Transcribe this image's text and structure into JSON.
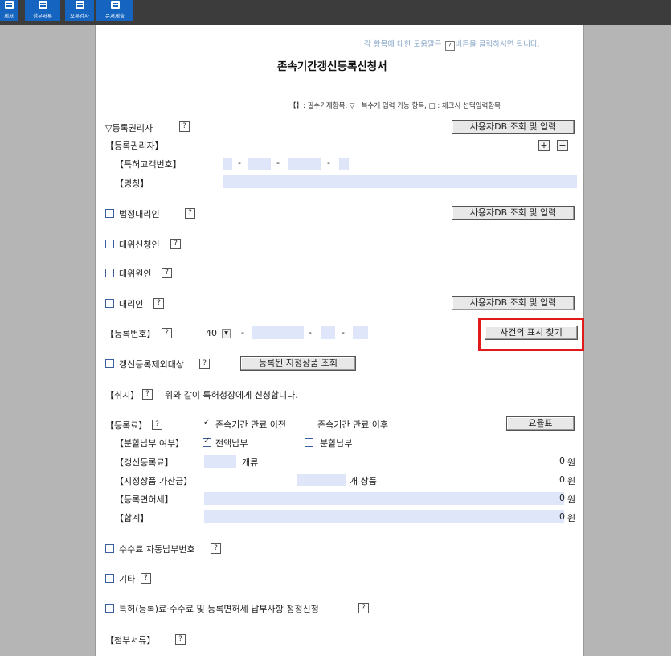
{
  "toolbar": {
    "buttons": [
      {
        "label": "세서"
      },
      {
        "label": "첨부서류"
      },
      {
        "label": "오류검사"
      },
      {
        "label": "문서제출"
      }
    ]
  },
  "doc": {
    "help_text_pre": "각 항목에 대한 도움말은",
    "help_text_post": "버튼을 클릭하시면 됩니다.",
    "qmark": "?",
    "title": "존속기간갱신등록신청서",
    "legend": "【】: 필수기재항목,  ▽ : 복수개 입력 가능 항목,  □ : 체크시 선택입력항목",
    "registrant_section": "▽등록권리자",
    "registrant_header": "【등록권리자】",
    "customer_no_label": "【특허고객번호】",
    "name_label": "【명칭】",
    "legal_rep_label": "법정대리인",
    "proxy_applicant_label": "대위신청인",
    "proxy_origin_label": "대위원인",
    "agent_label": "대리인",
    "reg_no_label": "【등록번호】",
    "reg_no_prefix": "40",
    "renewal_exclusion_label": "갱신등록제외대상",
    "purpose_label": "【취지】",
    "purpose_text": "위와 같이 특허청장에게 신청합니다.",
    "fee_label": "【등록료】",
    "before_expiry": "존속기간 만료 이전",
    "after_expiry": "존속기간 만료 이후",
    "installment_label": "【분할납부 여부】",
    "full_payment": "전액납부",
    "installment": "분할납부",
    "renewal_fee_label": "【갱신등록료】",
    "class_suffix": "개류",
    "designated_goods_label": "【지정상품 가산금】",
    "goods_suffix": "개 상품",
    "license_tax_label": "【등록면허세】",
    "total_label": "【합계】",
    "amount_zero": "0",
    "won": "원",
    "auto_pay_label": "수수료 자동납부번호",
    "other_label": "기타",
    "correction_label": "특허(등록)료·수수료 및 등록면허세 납부사항 정정신청",
    "attachments_label": "【첨부서류】",
    "plus": "+",
    "minus": "−",
    "dash": "-"
  },
  "buttons": {
    "user_db": "사용자DB 조회 및 입력",
    "find_case": "사건의 표시 찾기",
    "view_goods": "등록된 지정상품 조회",
    "fee_table": "요율표"
  },
  "colors": {
    "accent": "#1565c0",
    "field_bg": "#dfe6fa",
    "highlight": "#e11919"
  }
}
